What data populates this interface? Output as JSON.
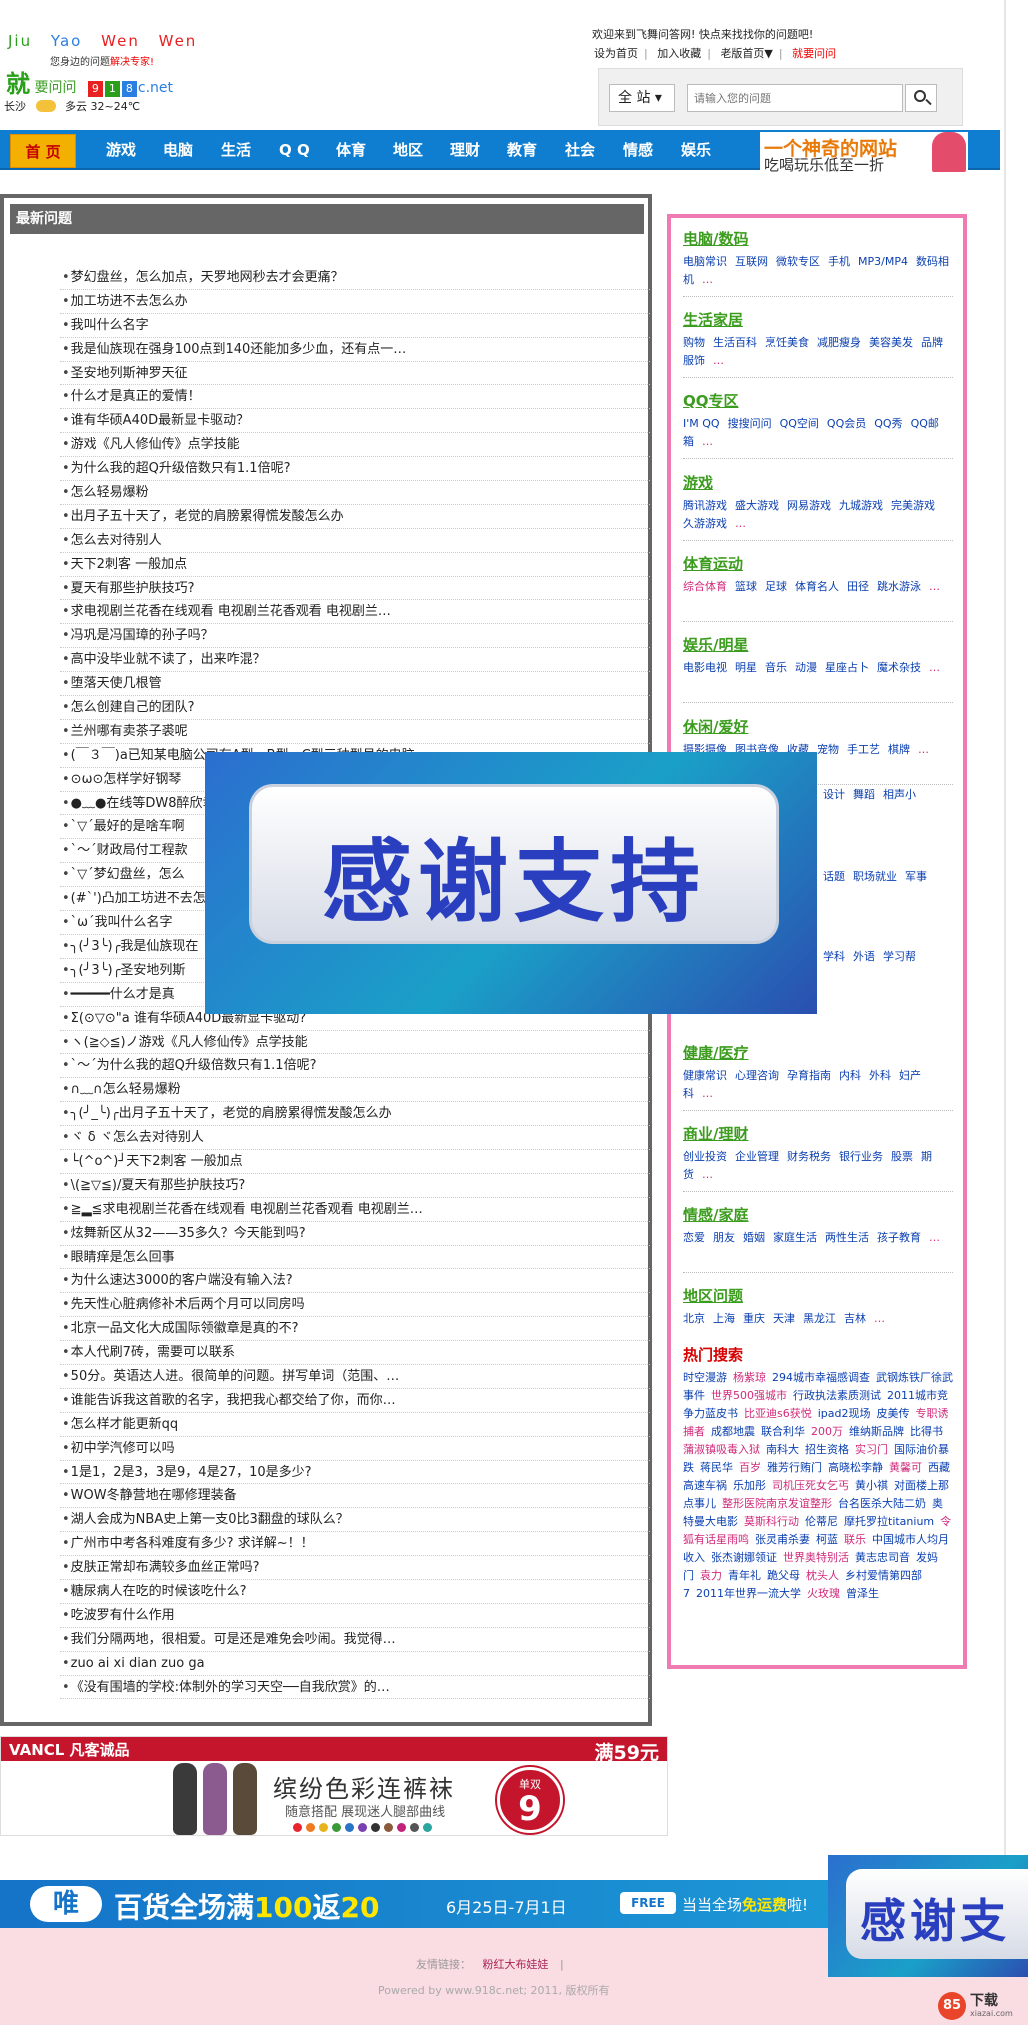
{
  "header": {
    "logo_words": [
      "Jiu",
      "Yao",
      "Wen",
      "Wen"
    ],
    "logo_slogan_a": "您身边的问题",
    "logo_slogan_b": "解决专家!",
    "logo_big": "就",
    "logo_cn": "要问问",
    "logo_site_chars": [
      "9",
      "1",
      "8"
    ],
    "logo_site_suffix": "c.net",
    "city": "长沙",
    "weather": "多云",
    "temp": "32~24℃",
    "welcome": "欢迎来到飞舞问答网! 快点来找找你的问题吧!",
    "links": [
      "设为首页",
      "加入收藏",
      "老版首页▼",
      "就要问问"
    ],
    "search_scope": "全 站",
    "search_placeholder": "请输入您的问题"
  },
  "nav": {
    "home": "首 页",
    "items": [
      "游戏",
      "电脑",
      "生活",
      "Q Q",
      "体育",
      "地区",
      "理财",
      "教育",
      "社会",
      "情感",
      "娱乐"
    ],
    "banner_line1": "一个神奇的网站",
    "banner_line2": "吃喝玩乐低至一折"
  },
  "left": {
    "title": "最新问题",
    "questions": [
      "梦幻盘丝，怎么加点，天罗地网秒去才会更痛？",
      "加工坊进不去怎么办",
      "我叫什么名字",
      "我是仙族现在强身100点到140还能加多少血，还有点一…",
      "圣安地列斯神罗天征",
      "什么才是真正的爱情！",
      "谁有华硕A40D最新显卡驱动？",
      "游戏《凡人修仙传》点学技能",
      "为什么我的超Q升级倍数只有1.1倍呢?",
      "怎么轻易爆粉",
      "出月子五十天了，老觉的肩膀累得慌发酸怎么办",
      "怎么去对待别人",
      "天下2刺客 一般加点",
      "夏天有那些护肤技巧?",
      "求电视剧兰花香在线观看 电视剧兰花香观看 电视剧兰…",
      "冯巩是冯国璋的孙子吗？",
      "高中没毕业就不读了，出来咋混？",
      "堕落天使几根管",
      "怎么创建自己的团队?",
      "兰州哪有卖茶子裘呢",
      "(￣３￣)a已知某电脑公司有A型、B型、C型三种型号的电脑",
      "⊙ω⊙怎样学好钢琴",
      "●﹏●在线等DW8醉欣幸",
      "`▽´最好的是啥车啊",
      "`～´财政局付工程款",
      "`▽´梦幻盘丝，怎么",
      "(#`')凸加工坊进不去怎",
      "`ω´我叫什么名字",
      "╮(╯3╰)╭我是仙族现在",
      "╮(╯3╰)╭圣安地列斯",
      "━━━━━什么才是真",
      "Σ(⊙▽⊙\"a 谁有华硕A40D最新显卡驱动?",
      "ヽ(≧◇≦)ノ游戏《凡人修仙传》点学技能",
      "`～´为什么我的超Q升级倍数只有1.1倍呢?",
      "∩﹏∩怎么轻易爆粉",
      "╮(╯_╰)╭出月子五十天了，老觉的肩膀累得慌发酸怎么办",
      "ヾ δ ヾ怎么去对待别人",
      "└(^o^)┘天下2刺客 一般加点",
      "\\(≧▽≦)/夏天有那些护肤技巧?",
      "≧▂≦求电视剧兰花香在线观看 电视剧兰花香观看 电视剧兰…",
      "炫舞新区从32——35多久？今天能到吗?",
      "眼睛痒是怎么回事",
      "为什么速达3000的客户端没有输入法?",
      "先天性心脏病修补术后两个月可以同房吗",
      "北京一品文化大成国际领徽章是真的不?",
      "本人代刷7砖，需要可以联系",
      "50分。英语达人进。很简单的问题。拼写单词（范围、…",
      "谁能告诉我这首歌的名字，我把我心都交给了你，而你…",
      "怎么样才能更新qq",
      "初中学汽修可以吗",
      "1是1，2是3，3是9，4是27，10是多少?",
      "WOW冬静营地在哪修理装备",
      "湖人会成为NBA史上第一支0比3翻盘的球队么？",
      "广州市中考各科难度有多少? 求详解~！！",
      "皮肤正常却布满较多血丝正常吗?",
      "糖尿病人在吃的时候该吃什么?",
      "吃波罗有什么作用",
      "我们分隔两地，很相爱。可是还是难免会吵闹。我觉得…",
      "zuo ai xi dian zuo ga",
      "《没有围墙的学校:体制外的学习天空──自我欣赏》的…"
    ]
  },
  "right": {
    "categories": [
      {
        "title": "电脑/数码",
        "links": [
          "电脑常识",
          "互联网",
          "微软专区",
          "手机",
          "MP3/MP4",
          "数码相机"
        ]
      },
      {
        "title": "生活家居",
        "links": [
          "购物",
          "生活百科",
          "烹饪美食",
          "减肥瘦身",
          "美容美发",
          "品牌服饰"
        ]
      },
      {
        "title": "QQ专区",
        "links": [
          "I'M QQ",
          "搜搜问问",
          "QQ空间",
          "QQ会员",
          "QQ秀",
          "QQ邮箱"
        ]
      },
      {
        "title": "游戏",
        "links": [
          "腾讯游戏",
          "盛大游戏",
          "网易游戏",
          "九城游戏",
          "完美游戏",
          "久游游戏"
        ]
      },
      {
        "title": "体育运动",
        "links": [
          "综合体育",
          "篮球",
          "足球",
          "体育名人",
          "田径",
          "跳水游泳"
        ]
      },
      {
        "title": "娱乐/明星",
        "links": [
          "电影电视",
          "明星",
          "音乐",
          "动漫",
          "星座占卜",
          "魔术杂技"
        ]
      },
      {
        "title": "休闲/爱好",
        "links": [
          "摄影摄像",
          "图书音像",
          "收藏",
          "宠物",
          "手工艺",
          "棋牌"
        ]
      },
      {
        "title": "",
        "links": [
          "设计",
          "舞蹈",
          "相声小"
        ]
      },
      {
        "title": "",
        "links": [
          "话题",
          "职场就业",
          "军事"
        ]
      },
      {
        "title": "",
        "links": [
          "学科",
          "外语",
          "学习帮"
        ]
      },
      {
        "title": "健康/医疗",
        "links": [
          "健康常识",
          "心理咨询",
          "孕育指南",
          "内科",
          "外科",
          "妇产科"
        ]
      },
      {
        "title": "商业/理财",
        "links": [
          "创业投资",
          "企业管理",
          "财务税务",
          "银行业务",
          "股票",
          "期货"
        ]
      },
      {
        "title": "情感/家庭",
        "links": [
          "恋爱",
          "朋友",
          "婚姻",
          "家庭生活",
          "两性生活",
          "孩子教育"
        ]
      },
      {
        "title": "地区问题",
        "links": [
          "北京",
          "上海",
          "重庆",
          "天津",
          "黑龙江",
          "吉林"
        ]
      }
    ],
    "more": "…",
    "hot_title": "热门搜索",
    "hot": [
      "时空漫游",
      "杨紫琼",
      "294城市幸福感调查",
      "武钢炼铁厂徐武事件",
      "世界500强城市",
      "行政执法素质测试",
      "2011城市竞争力蓝皮书",
      "比亚迪s6获悦",
      "ipad2现场",
      "皮美传",
      "专职诱捕者",
      "成都地震",
      "联合利华",
      "200万",
      "维纳斯品牌",
      "比得书",
      "蒲淑镇吸毒入狱",
      "南科大",
      "招生资格",
      "实习门",
      "国际油价暴跌",
      "蒋民华",
      "百岁",
      "雅芳行贿门",
      "高晓松李静",
      "黄馨可",
      "西藏高速车祸",
      "乐加彤",
      "司机压死女乞丐",
      "黄小祺",
      "对面楼上那点事儿",
      "整形医院南京发谊整形",
      "台名医杀大陆二奶",
      "奥特曼大电影",
      "莫斯科行动",
      "伦蒂尼",
      "摩托罗拉titanium",
      "令狐有话星雨鸣",
      "张灵甫杀妻",
      "柯蓝",
      "联乐",
      "中国城市人均月收入",
      "张杰谢娜领证",
      "世界奥特别活",
      "黄志忠司音",
      "发妈门",
      "袁力",
      "青年礼",
      "跪父母",
      "枕头人",
      "乡村爱情第四部7",
      "2011年世界一流大学",
      "火玫瑰",
      "曾泽生"
    ]
  },
  "overlay": {
    "thanks_text": "感谢支持"
  },
  "ads": {
    "vancl_logo": "VANCL 凡客诚品",
    "vancl_promo": "满59元",
    "vancl_title": "缤纷色彩连裤袜",
    "vancl_sub": "随意搭配  展现迷人腿部曲线",
    "vancl_badge_top": "单双",
    "vancl_badge_num": "9",
    "vancl_dot_colors": [
      "#e9242d",
      "#f07a1f",
      "#e6b51c",
      "#3a9a3a",
      "#2a74c6",
      "#7a3fb0",
      "#333333",
      "#8a5a3a",
      "#c2227a",
      "#555555",
      "#2aa5a0"
    ],
    "big_logo": "唯",
    "big_main_a": "百货全场满",
    "big_main_b": "100",
    "big_main_c": "返",
    "big_main_d": "20",
    "big_date": "6月25日-7月1日",
    "big_free": "FREE",
    "big_ship_a": "当当全场",
    "big_ship_b": "免运费",
    "big_ship_c": "啦!",
    "thanks2": "感谢支"
  },
  "footer": {
    "label": "友情链接：",
    "link": "粉红大布娃娃",
    "sep": "|",
    "copy": "Powered by www.918c.net; 2011, 版权所有",
    "xiazai": "下载",
    "xiazai_url": "xiazai.com",
    "xiazai_num": "85"
  }
}
